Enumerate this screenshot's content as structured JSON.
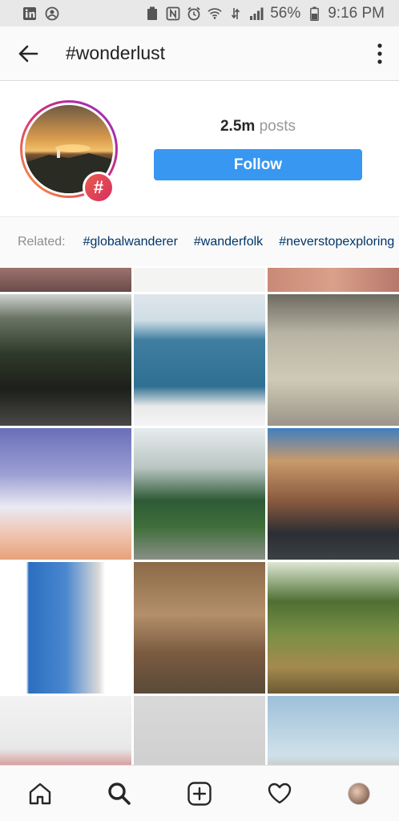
{
  "status_bar": {
    "battery": "56%",
    "time": "9:16 PM",
    "icons": [
      "linkedin-icon",
      "account-circle-icon",
      "recycle-icon",
      "nfc-icon",
      "alarm-icon",
      "wifi-icon",
      "data-icon",
      "signal-icon",
      "battery-icon"
    ]
  },
  "header": {
    "title": "#wonderlust",
    "back_icon": "arrow-left-icon",
    "more_icon": "more-vertical-icon"
  },
  "profile": {
    "posts_count": "2.5m",
    "posts_label": "posts",
    "follow_label": "Follow",
    "badge_symbol": "#"
  },
  "related": {
    "label": "Related:",
    "tags": [
      "#globalwanderer",
      "#wanderfolk",
      "#neverstopexploring"
    ]
  },
  "nav": {
    "items": [
      "home-icon",
      "search-icon",
      "add-post-icon",
      "heart-icon",
      "profile-avatar"
    ]
  },
  "colors": {
    "accent": "#3897f0",
    "tag": "#003569",
    "muted": "#8e8e8e"
  }
}
